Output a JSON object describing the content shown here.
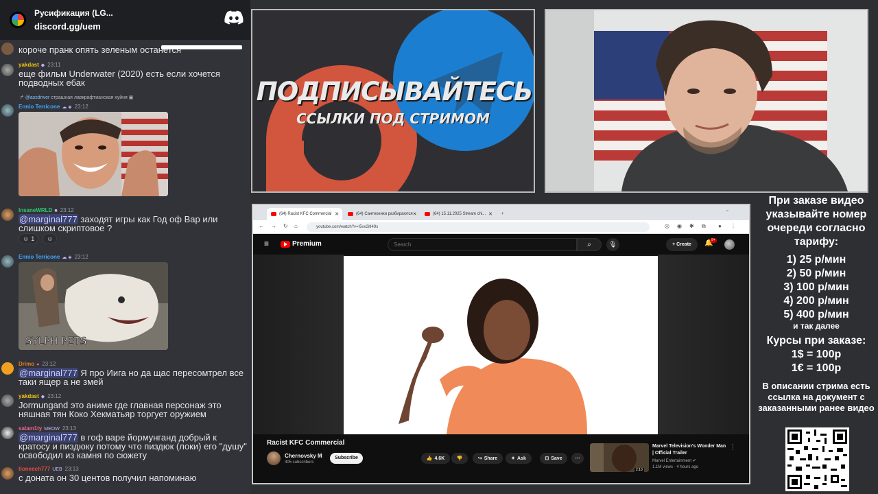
{
  "discord": {
    "server_name": "Русификация (LG...",
    "invite": "discord.gg/uem",
    "messages": [
      {
        "text": "короче пранк опять зеленым останется"
      },
      {
        "user": "yakdast",
        "time": "23:11",
        "text": "еще фильм Underwater (2020) есть если хочется подводных ебак"
      },
      {
        "reply_to": "@assdriver",
        "reply_text": "страшная лавкрафтианская хуйня",
        "user": "Ennio Terricone",
        "time": "23:12"
      },
      {
        "user": "InsaneWRLD",
        "time": "23:12",
        "mention": "@marginal777",
        "text": " заходят игры как Год оф Вар или слишком скриптовое ?",
        "reaction_count": "1"
      },
      {
        "user": "Ennio Terricone",
        "time": "23:12",
        "image_caption": "SYLPH PETS"
      },
      {
        "user": "Drimo",
        "time": "23:12",
        "mention": "@marginal777",
        "text": " Я про Иига но да щас пересомтрел все таки ящер а не змей"
      },
      {
        "user": "yakdast",
        "time": "23:12",
        "text": "Jormungand это аниме где главная персонаж это няшная тян Коко Хекматьяр торгует оружием"
      },
      {
        "user": "salam1ty",
        "badge": "MEOW",
        "time": "23:13",
        "mention": "@marginal777",
        "text": " в гоф варе йормунганд добрый к кратосу и пиздюку потому что пиздюк (локи) его \"душу\" освободил из камня по сюжету"
      },
      {
        "user": "tioneech777",
        "badge": "UEB",
        "time": "23:13",
        "text": "с доната он 30 центов получил напоминаю"
      }
    ]
  },
  "banner": {
    "line1": "ПОДПИСЫВАЙТЕСЬ",
    "line2": "ССЫЛКИ ПОД СТРИМОМ"
  },
  "browser": {
    "tabs": [
      {
        "label": "(64) Racist KFC Commercial"
      },
      {
        "label": "(64) Сантехники разбираются"
      },
      {
        "label": "(64) 15.11.2025 Stream chi..."
      }
    ],
    "url": "youtube.com/watch?v=I5vx2itI49s"
  },
  "youtube": {
    "logo_text": "Premium",
    "search_placeholder": "Search",
    "create_label": "Create",
    "notification_count": "9+",
    "video_title": "Racist KFC Commercial",
    "channel_name": "Chernovsky M",
    "subscribers": "405 subscribers",
    "subscribe_label": "Subscribe",
    "likes": "4.6K",
    "share_label": "Share",
    "ask_label": "Ask",
    "save_label": "Save",
    "recommended": {
      "title": "Marvel Television's Wonder Man | Official Trailer",
      "channel": "Marvel Entertainment",
      "views": "1.1M views · 4 hours ago",
      "duration": "2:10"
    }
  },
  "price_panel": {
    "intro": "При заказе видео указывайте номер очереди согласно тарифу:",
    "tiers": [
      "1) 25 р/мин",
      "2) 50 р/мин",
      "3) 100 р/мин",
      "4) 200 р/мин",
      "5) 400 р/мин"
    ],
    "tiers_note": "и так далее",
    "rates_title": "Курсы при заказе:",
    "rates": [
      "1$ = 100р",
      "1€ = 100р"
    ],
    "description": "В описании стрима есть ссылка на документ с заказанными ранее видео"
  }
}
